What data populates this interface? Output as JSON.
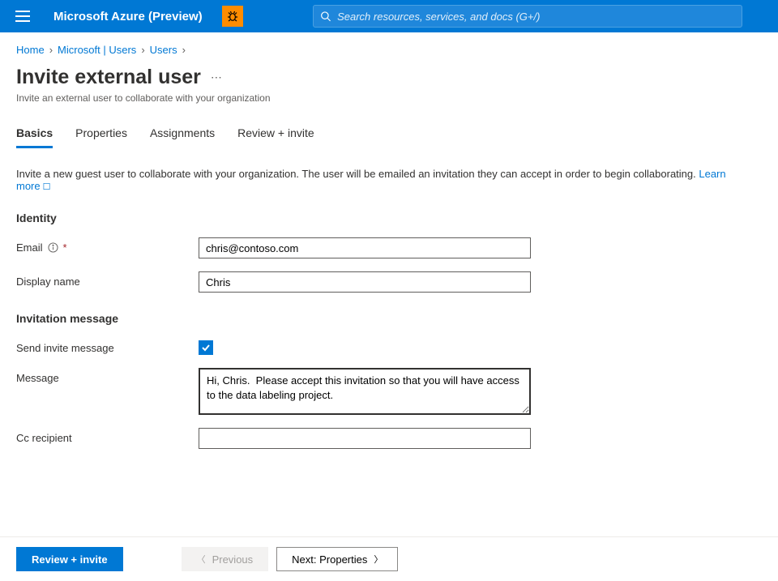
{
  "header": {
    "brand": "Microsoft Azure (Preview)",
    "search_placeholder": "Search resources, services, and docs (G+/)"
  },
  "breadcrumbs": [
    "Home",
    "Microsoft | Users",
    "Users"
  ],
  "page": {
    "title": "Invite external user",
    "subtitle": "Invite an external user to collaborate with your organization"
  },
  "tabs": [
    {
      "label": "Basics",
      "active": true
    },
    {
      "label": "Properties",
      "active": false
    },
    {
      "label": "Assignments",
      "active": false
    },
    {
      "label": "Review + invite",
      "active": false
    }
  ],
  "intro": {
    "text": "Invite a new guest user to collaborate with your organization. The user will be emailed an invitation they can accept in order to begin collaborating. ",
    "link": "Learn more"
  },
  "sections": {
    "identity": {
      "heading": "Identity",
      "email_label": "Email",
      "email_value": "chris@contoso.com",
      "display_name_label": "Display name",
      "display_name_value": "Chris"
    },
    "invitation": {
      "heading": "Invitation message",
      "send_invite_label": "Send invite message",
      "send_invite_checked": true,
      "message_label": "Message",
      "message_value": "Hi, Chris.  Please accept this invitation so that you will have access to the data labeling project.",
      "cc_label": "Cc recipient",
      "cc_value": ""
    }
  },
  "footer": {
    "review": "Review + invite",
    "previous": "Previous",
    "next": "Next: Properties"
  }
}
